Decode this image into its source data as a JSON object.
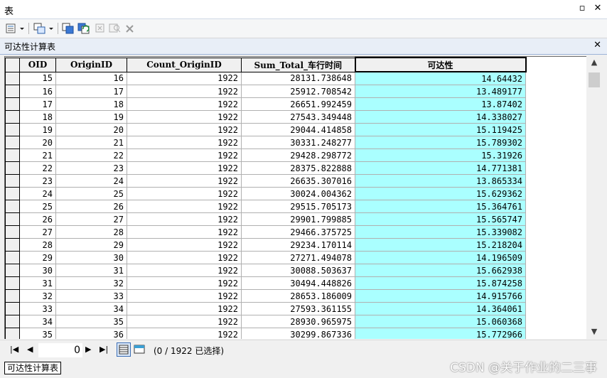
{
  "window": {
    "title": "表",
    "pin_glyph": "▫",
    "close_glyph": "✕"
  },
  "table_tab": {
    "title": "可达性计算表",
    "close_glyph": "✕"
  },
  "columns": [
    "OID",
    "OriginID",
    "Count_OriginID",
    "Sum_Total_车行时间",
    "可达性"
  ],
  "rows": [
    [
      "15",
      "16",
      "1922",
      "28131.738648",
      "14.64432"
    ],
    [
      "16",
      "17",
      "1922",
      "25912.708542",
      "13.489177"
    ],
    [
      "17",
      "18",
      "1922",
      "26651.992459",
      "13.87402"
    ],
    [
      "18",
      "19",
      "1922",
      "27543.349448",
      "14.338027"
    ],
    [
      "19",
      "20",
      "1922",
      "29044.414858",
      "15.119425"
    ],
    [
      "20",
      "21",
      "1922",
      "30331.248277",
      "15.789302"
    ],
    [
      "21",
      "22",
      "1922",
      "29428.298772",
      "15.31926"
    ],
    [
      "22",
      "23",
      "1922",
      "28375.822888",
      "14.771381"
    ],
    [
      "23",
      "24",
      "1922",
      "26635.307016",
      "13.865334"
    ],
    [
      "24",
      "25",
      "1922",
      "30024.004362",
      "15.629362"
    ],
    [
      "25",
      "26",
      "1922",
      "29515.705173",
      "15.364761"
    ],
    [
      "26",
      "27",
      "1922",
      "29901.799885",
      "15.565747"
    ],
    [
      "27",
      "28",
      "1922",
      "29466.375725",
      "15.339082"
    ],
    [
      "28",
      "29",
      "1922",
      "29234.170114",
      "15.218204"
    ],
    [
      "29",
      "30",
      "1922",
      "27271.494078",
      "14.196509"
    ],
    [
      "30",
      "31",
      "1922",
      "30088.503637",
      "15.662938"
    ],
    [
      "31",
      "32",
      "1922",
      "30494.448826",
      "15.874258"
    ],
    [
      "32",
      "33",
      "1922",
      "28653.186009",
      "14.915766"
    ],
    [
      "33",
      "34",
      "1922",
      "27593.361155",
      "14.364061"
    ],
    [
      "34",
      "35",
      "1922",
      "28930.965975",
      "15.060368"
    ],
    [
      "35",
      "36",
      "1922",
      "30299.867336",
      "15.772966"
    ]
  ],
  "navigation": {
    "first": "|◀",
    "prev": "◀",
    "current_record": "0",
    "next": "▶",
    "last": "▶|"
  },
  "status": "(0 / 1922 已选择)",
  "bottom_tab": "可达性计算表",
  "watermark": "CSDN @关于作业的二三事",
  "colors": {
    "selected_column": "#aaffff",
    "header_bg": "#f0f0f0"
  },
  "icons": [
    "table-options-icon",
    "related-tables-icon",
    "select-by-attributes-icon",
    "switch-selection-icon",
    "clear-selection-icon",
    "zoom-to-selected-icon",
    "delete-selected-icon"
  ]
}
